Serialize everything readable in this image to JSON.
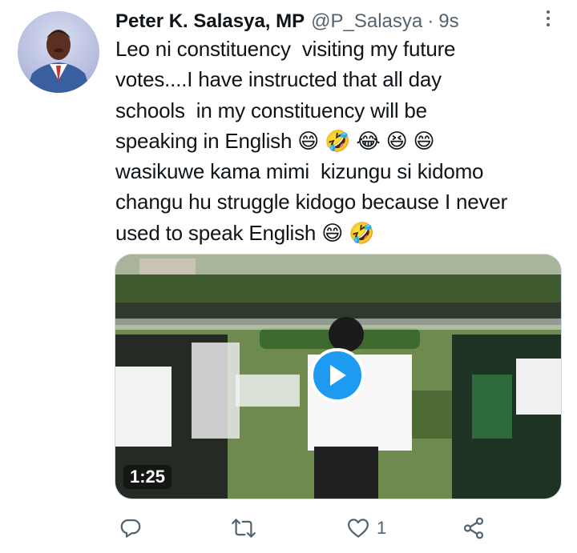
{
  "author": {
    "name": "Peter K. Salasya, MP",
    "handle": "@P_Salasya",
    "separator": "·",
    "time": "9s"
  },
  "tweet": {
    "lines": [
      "Leo ni constituency  visiting my future",
      "votes....I have instructed that all day",
      "schools  in my constituency will be",
      "speaking in English 😄 🤣 😂 😆 😄",
      "wasikuwe kama mimi  kizungu si kidomo",
      "changu hu struggle kidogo because I never",
      "used to speak English 😄 🤣"
    ]
  },
  "media": {
    "duration": "1:25",
    "play_icon": "play-icon"
  },
  "actions": {
    "reply_icon": "reply-icon",
    "retweet_icon": "retweet-icon",
    "like_icon": "heart-icon",
    "like_count": "1",
    "share_icon": "share-icon"
  },
  "colors": {
    "accent": "#1d9bf0",
    "secondary_text": "#536471",
    "primary_text": "#0f1419"
  }
}
